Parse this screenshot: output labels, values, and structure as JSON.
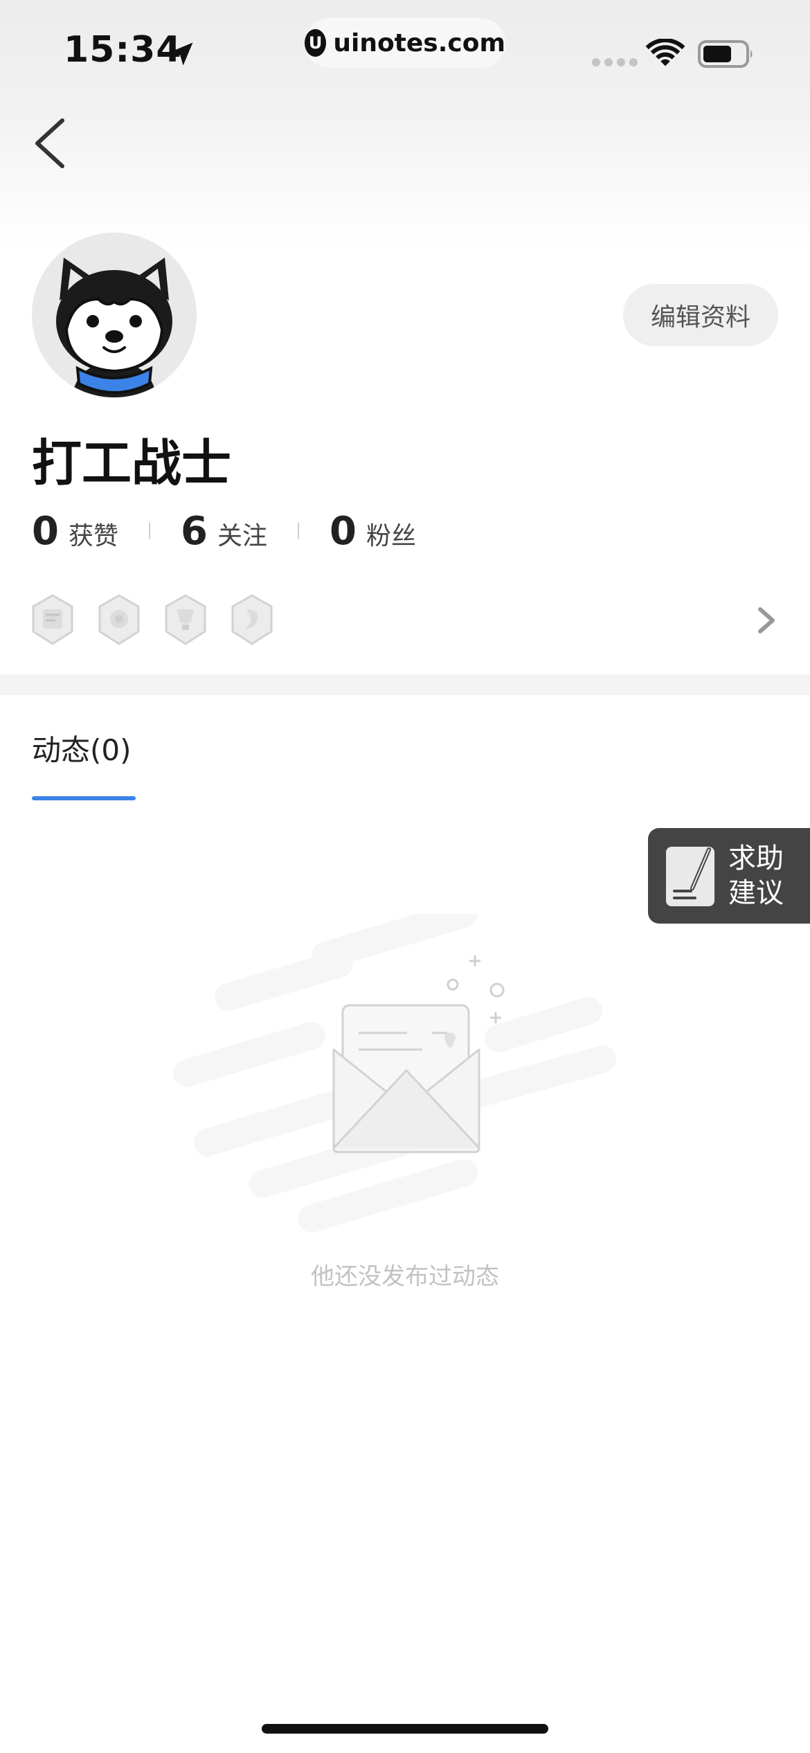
{
  "status_bar": {
    "time": "15:34",
    "url": "uinotes.com",
    "url_logo": "U",
    "icons": [
      "location-arrow-icon",
      "signal-icon",
      "wifi-icon",
      "battery-icon"
    ]
  },
  "nav": {
    "back_icon": "chevron-left-icon"
  },
  "profile": {
    "username": "打工战士",
    "edit_label": "编辑资料",
    "avatar": "husky-dog-avatar",
    "stats": [
      {
        "value": "0",
        "label": "获赞"
      },
      {
        "value": "6",
        "label": "关注"
      },
      {
        "value": "0",
        "label": "粉丝"
      }
    ],
    "badges": [
      "medal-badge-icon",
      "medal-badge-icon",
      "medal-badge-icon",
      "medal-badge-icon"
    ]
  },
  "tabs": {
    "active_label": "动态(0)"
  },
  "empty_state": {
    "message": "他还没发布过动态",
    "illustration": "empty-envelope-illustration"
  },
  "help_float": {
    "line1": "求助",
    "line2": "建议"
  },
  "colors": {
    "accent": "#3b83e6",
    "help_bg": "#444444",
    "edit_bg": "#efefef"
  }
}
